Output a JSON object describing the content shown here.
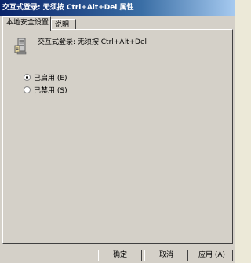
{
  "window": {
    "title": "交互式登录: 无须按 Ctrl+Alt+Del 属性"
  },
  "tabs": [
    {
      "label": "本地安全设置",
      "active": true
    },
    {
      "label": "说明",
      "active": false
    }
  ],
  "policy": {
    "title": "交互式登录: 无须按 Ctrl+Alt+Del",
    "icon": "security-policy-icon"
  },
  "options": {
    "enabled_label": "已启用 (E)",
    "disabled_label": "已禁用 (S)",
    "selected": "enabled"
  },
  "buttons": {
    "ok_label": "确定",
    "cancel_label": "取消",
    "apply_label": "应用 (A)"
  }
}
